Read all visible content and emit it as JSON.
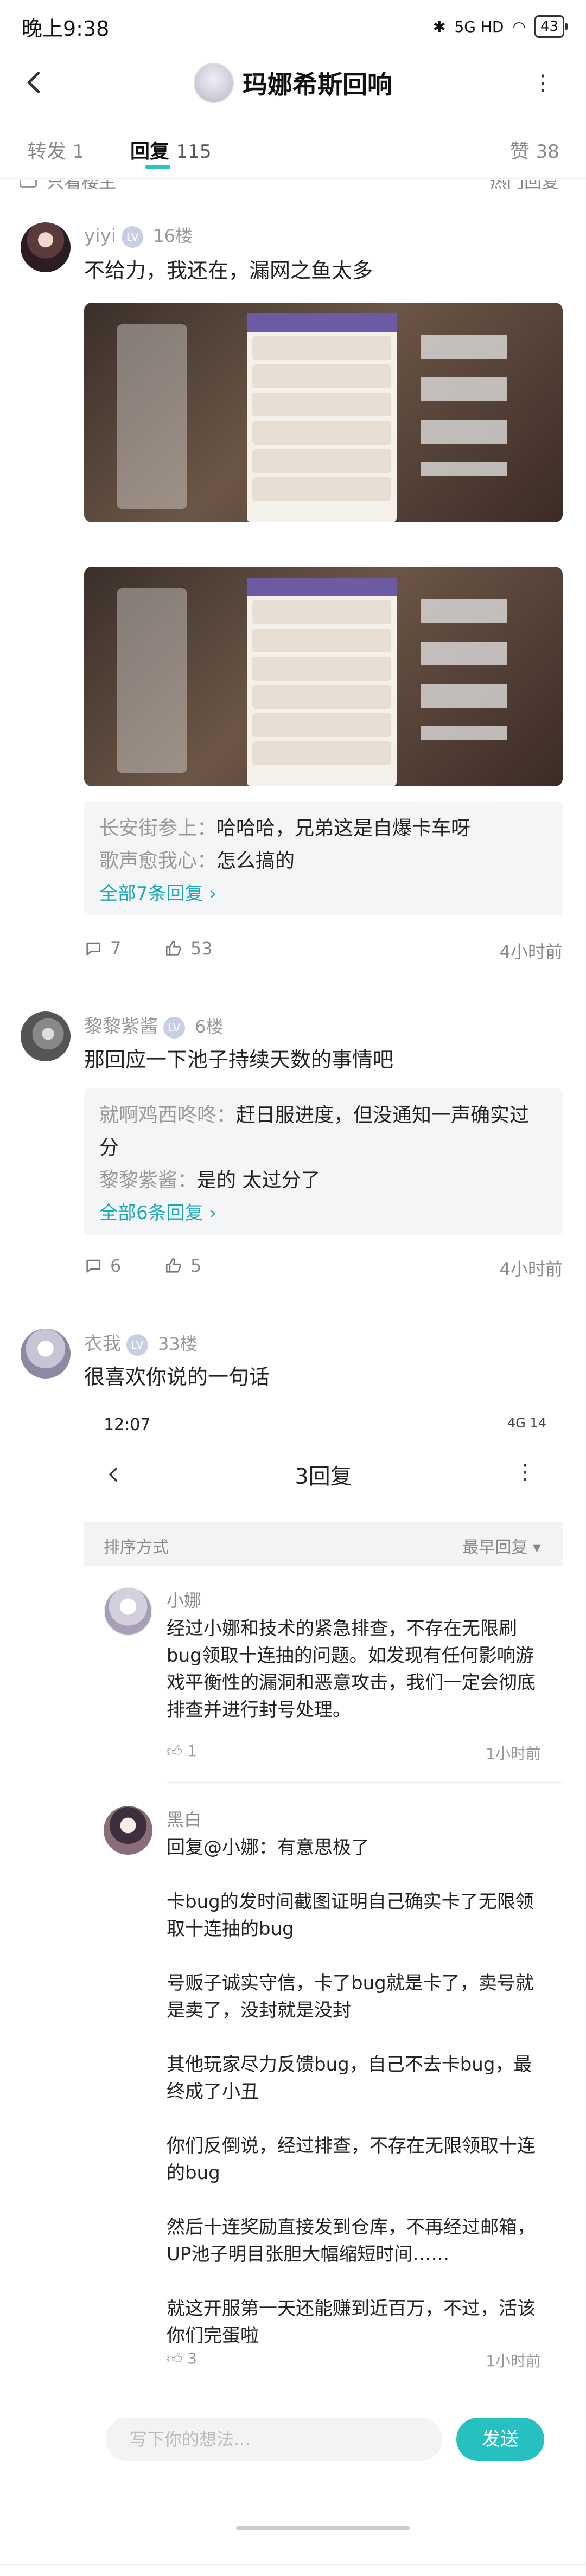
{
  "status_bar": {
    "time": "晚上9:38",
    "signal": "5G HD",
    "wifi": "wifi",
    "battery": "43"
  },
  "header": {
    "title": "玛娜希斯回响",
    "more": "⋮"
  },
  "tabs": [
    {
      "label": "转发",
      "count": "1"
    },
    {
      "label": "回复",
      "count": "115"
    },
    {
      "label": "赞",
      "count": "38"
    }
  ],
  "peek": {
    "left": "只看楼主",
    "right": "热门回复"
  },
  "comments": [
    {
      "user": "yiyi",
      "level": "LV",
      "floor": "16楼",
      "text": "不给力，我还在，漏网之鱼太多",
      "replies": [
        {
          "name": "长安街参上",
          "body": "哈哈哈，兄弟这是自爆卡车呀"
        },
        {
          "name": "歌声愈我心",
          "body": "怎么搞的"
        }
      ],
      "more": "全部7条回复 ›",
      "comments_count": "7",
      "likes": "53",
      "time": "4小时前"
    },
    {
      "user": "黎黎紫酱",
      "level": "LV",
      "floor": "6楼",
      "text": "那回应一下池子持续天数的事情吧",
      "replies": [
        {
          "name": "就啊鸡西咚咚",
          "body": "赶日服进度，但没通知一声确实过分"
        },
        {
          "name": "黎黎紫酱",
          "body": "是的    太过分了"
        }
      ],
      "more": "全部6条回复 ›",
      "comments_count": "6",
      "likes": "5",
      "time": "4小时前"
    },
    {
      "user": "衣我",
      "level": "LV",
      "floor": "33楼",
      "text": "很喜欢你说的一句话"
    }
  ],
  "embed": {
    "status_time": "12:07",
    "status_right": "4G 14",
    "title": "3回复",
    "more": "⋮",
    "sort_label": "排序方式",
    "sort_value": "最早回复 ▾",
    "replies": [
      {
        "name": "小娜",
        "text": "经过小娜和技术的紧急排查，不存在无限刷bug领取十连抽的问题。如发现有任何影响游戏平衡性的漏洞和恶意攻击，我们一定会彻底排查并进行封号处理。",
        "likes": "1",
        "time": "1小时前"
      },
      {
        "name": "黑白",
        "text": "回复@小娜：有意思极了\n\n卡bug的发时间截图证明自己确实卡了无限领取十连抽的bug\n\n号贩子诚实守信，卡了bug就是卡了，卖号就是卖了，没封就是没封\n\n其他玩家尽力反馈bug，自己不去卡bug，最终成了小丑\n\n你们反倒说，经过排查，不存在无限领取十连的bug\n\n然后十连奖励直接发到仓库，不再经过邮箱，UP池子明目张胆大幅缩短时间……\n\n就这开服第一天还能赚到近百万，不过，活该你们完蛋啦",
        "likes": "3",
        "time": "1小时前"
      }
    ],
    "input_placeholder": "写下你的想法...",
    "send_label": "发送"
  }
}
